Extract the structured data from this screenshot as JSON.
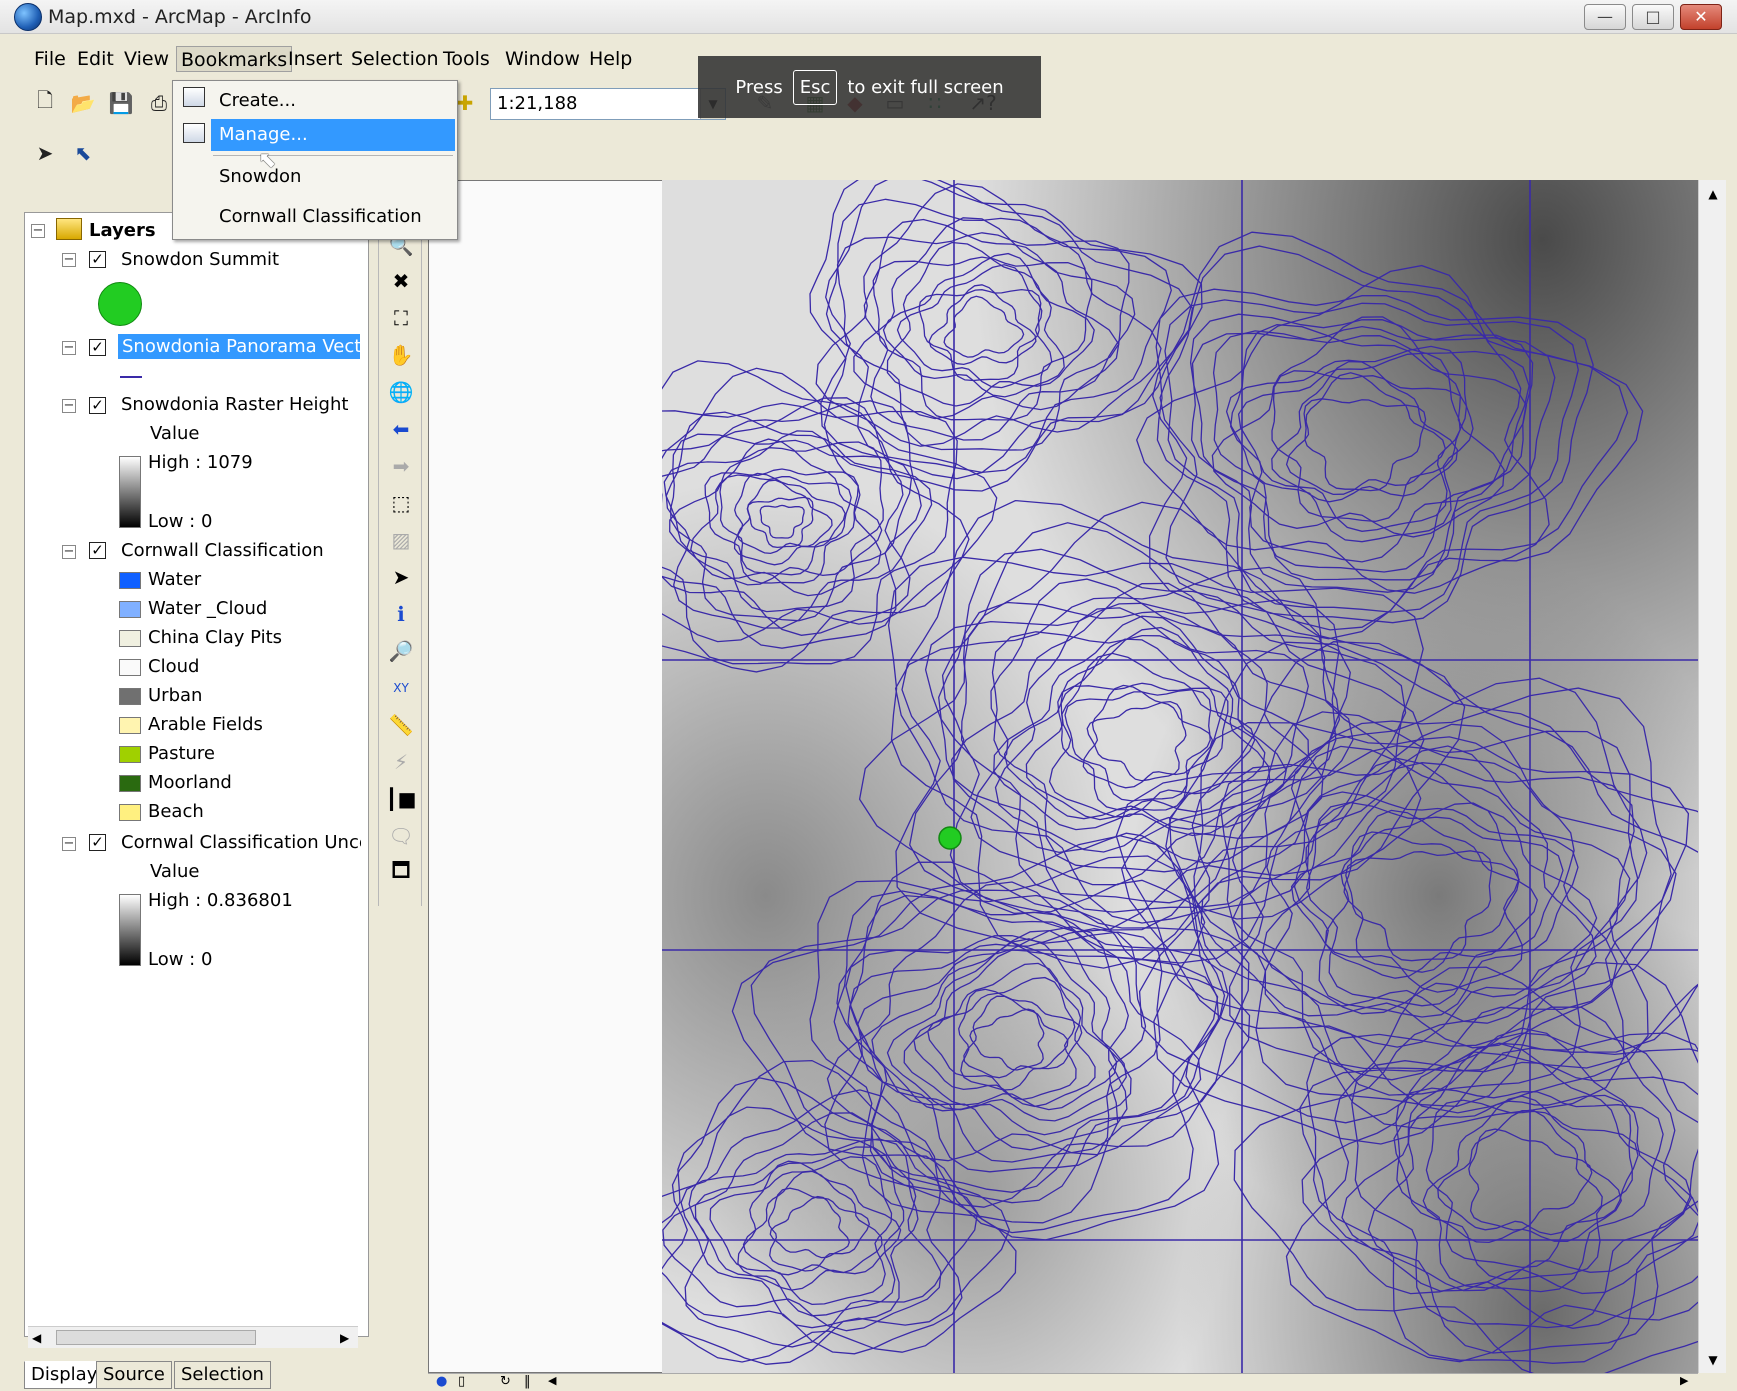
{
  "window": {
    "title": "Map.mxd - ArcMap - ArcInfo",
    "minimize": "—",
    "maximize": "□",
    "close": "✕"
  },
  "menu": {
    "items": [
      "File",
      "Edit",
      "View",
      "Bookmarks",
      "Insert",
      "Selection",
      "Tools",
      "Window",
      "Help"
    ],
    "active": "Bookmarks"
  },
  "toolbar": {
    "scale": "1:21,188"
  },
  "fullscreen_notice": {
    "press": "Press",
    "key": "Esc",
    "rest": "to exit full screen"
  },
  "bookmarks_menu": {
    "create": "Create...",
    "manage": "Manage...",
    "bookmarks": [
      "Snowdon",
      "Cornwall Classification"
    ]
  },
  "toc": {
    "root": "Layers",
    "layers": [
      {
        "name": "Snowdon Summit",
        "checked": true
      },
      {
        "name": "Snowdonia Panorama Vecto",
        "checked": true,
        "selected": true
      },
      {
        "name": "Snowdonia Raster Height",
        "checked": true,
        "field": "Value",
        "high": "High : 1079",
        "low": "Low : 0"
      },
      {
        "name": "Cornwall Classification",
        "checked": true,
        "classes": [
          {
            "label": "Water",
            "color": "#1060ff"
          },
          {
            "label": "Water _Cloud",
            "color": "#80b0ff"
          },
          {
            "label": "China Clay Pits",
            "color": "#f0f0e0"
          },
          {
            "label": "Cloud",
            "color": "#fafafa"
          },
          {
            "label": "Urban",
            "color": "#707070"
          },
          {
            "label": "Arable Fields",
            "color": "#fff4b0"
          },
          {
            "label": "Pasture",
            "color": "#a0d000"
          },
          {
            "label": "Moorland",
            "color": "#2a6a10"
          },
          {
            "label": "Beach",
            "color": "#fff080"
          }
        ]
      },
      {
        "name": "Cornwal Classification Unce",
        "checked": true,
        "field": "Value",
        "high": "High : 0.836801",
        "low": "Low : 0"
      }
    ],
    "tabs": [
      "Display",
      "Source",
      "Selection"
    ]
  },
  "colors": {
    "contour": "#3a2aa8",
    "summit_point": "#22cc22",
    "selection": "#3399ff"
  },
  "icons": [
    "new-icon",
    "open-icon",
    "save-icon",
    "print-icon",
    "select-arrow-icon",
    "select-features-icon",
    "zoom-out-icon",
    "fixed-zoom-in-icon",
    "fixed-zoom-out-icon",
    "pan-icon",
    "full-extent-icon",
    "back-icon",
    "forward-icon",
    "select-elements-icon",
    "identify-icon",
    "find-icon",
    "goto-xy-icon",
    "measure-icon",
    "hyperlink-icon",
    "time-slider-icon",
    "html-popup-icon",
    "viewer-icon"
  ]
}
